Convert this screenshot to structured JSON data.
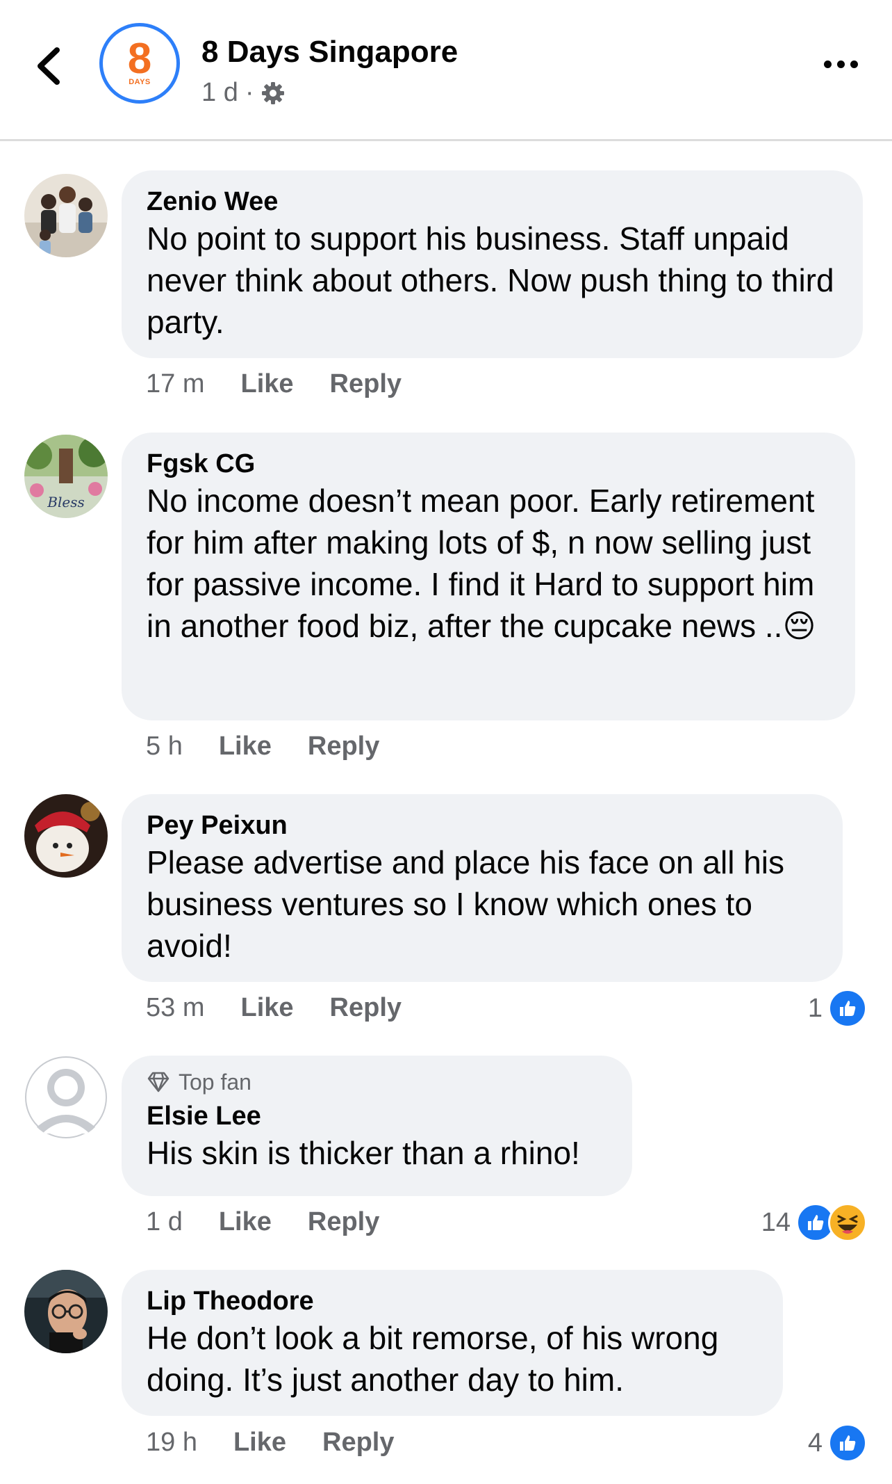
{
  "header": {
    "page_name": "8 Days Singapore",
    "time": "1 d",
    "separator": "·",
    "logo_number": "8",
    "logo_text": "DAYS"
  },
  "comments": [
    {
      "author": "Zenio Wee",
      "text": "No point to support his business. Staff unpaid never think about others. Now push thing to third party.",
      "time": "17 m",
      "like_label": "Like",
      "reply_label": "Reply"
    },
    {
      "author": "Fgsk CG",
      "text": "No income doesn’t mean poor. Early retirement for him after making lots of $, n now selling just for passive income. I find it Hard to support him in another food biz, after the cupcake news ..😔",
      "time": "5 h",
      "like_label": "Like",
      "reply_label": "Reply"
    },
    {
      "author": "Pey Peixun",
      "text": "Please advertise and place his face on all his business ventures so I know which ones to avoid!",
      "time": "53 m",
      "like_label": "Like",
      "reply_label": "Reply",
      "reaction_count": "1"
    },
    {
      "badge": "Top fan",
      "author": "Elsie Lee",
      "text": "His skin is thicker than a rhino!",
      "time": "1 d",
      "like_label": "Like",
      "reply_label": "Reply",
      "reaction_count": "14"
    },
    {
      "author": "Lip Theodore",
      "text": "He don’t look a bit remorse, of his wrong doing. It’s just another day to him.",
      "time": "19 h",
      "like_label": "Like",
      "reply_label": "Reply",
      "reaction_count": "4"
    }
  ],
  "colors": {
    "accent": "#1877f2",
    "bubble": "#f0f2f5",
    "muted": "#65676b",
    "logo_orange": "#f36f21",
    "logo_ring": "#2d7ff9"
  }
}
